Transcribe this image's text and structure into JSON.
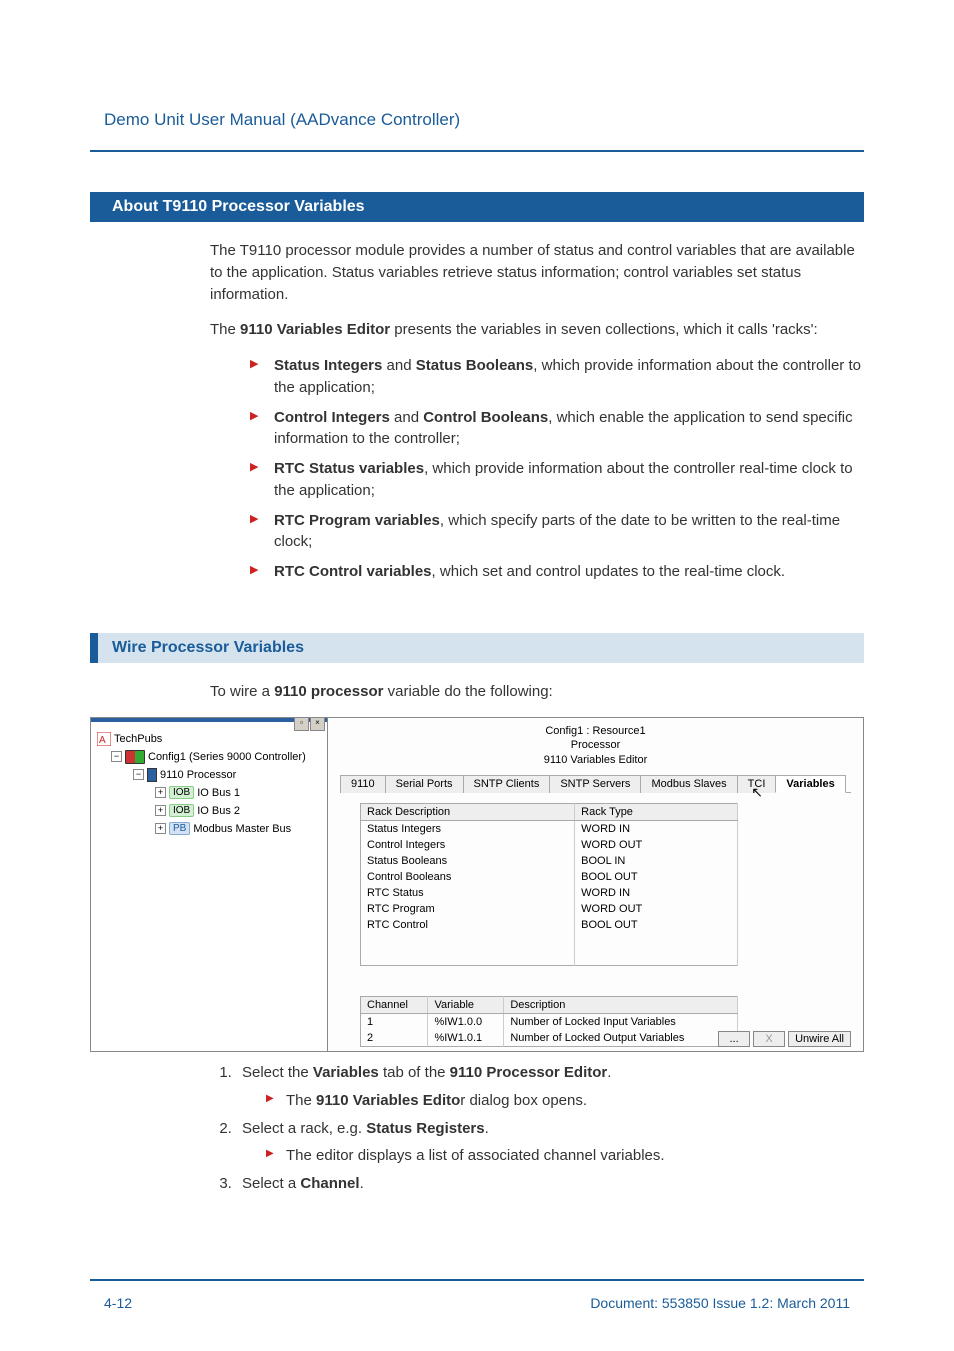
{
  "header": {
    "title": "Demo Unit User Manual  (AADvance Controller)"
  },
  "section1": {
    "heading": "About T9110 Processor Variables",
    "para1": "The T9110 processor module provides a number of status and control variables that are available to the application. Status variables retrieve status information; control variables set status information.",
    "para2_pre": "The ",
    "para2_b": "9110 Variables Editor",
    "para2_post": " presents the variables in seven collections, which it calls 'racks':",
    "bullets": {
      "b1_b1": "Status Integers",
      "b1_mid": " and ",
      "b1_b2": "Status Booleans",
      "b1_post": ", which provide information about the controller to the application;",
      "b2_b1": "Control Integers",
      "b2_mid": " and ",
      "b2_b2": "Control Booleans",
      "b2_post": ", which enable the application to send specific information to the controller;",
      "b3_b": "RTC Status variables",
      "b3_post": ", which provide information about the controller real-time clock to the application;",
      "b4_b": "RTC Program variables",
      "b4_post": ", which specify parts of the date to be written to the real-time clock;",
      "b5_b": "RTC Control variables",
      "b5_post": ", which set and control updates to the real-time clock."
    }
  },
  "section2": {
    "heading": "Wire Processor Variables",
    "intro_pre": "To wire a ",
    "intro_b": "9110 processor",
    "intro_post": " variable do the following:",
    "steps": {
      "s1_pre": "Select the ",
      "s1_b1": "Variables",
      "s1_mid": " tab of the ",
      "s1_b2": "9110 Processor Editor",
      "s1_post": ".",
      "s1_sub_pre": "The ",
      "s1_sub_b": "9110 Variables Edito",
      "s1_sub_post": "r dialog box opens.",
      "s2_pre": "Select a rack, e.g. ",
      "s2_b": "Status Registers",
      "s2_post": ".",
      "s2_sub": "The editor displays a list of associated channel variables.",
      "s3_pre": "Select a ",
      "s3_b": "Channel",
      "s3_post": "."
    }
  },
  "screenshot": {
    "tree": {
      "root": "TechPubs",
      "config": "Config1 (Series 9000 Controller)",
      "processor": "9110 Processor",
      "io1_chip": "IOB",
      "io1": "IO Bus 1",
      "io2_chip": "IOB",
      "io2": "IO Bus 2",
      "pb_chip": "PB",
      "pb": "Modbus Master Bus"
    },
    "right": {
      "crumb1": "Config1 : Resource1",
      "crumb2": "Processor",
      "crumb3": "9110 Variables Editor",
      "tabs": [
        "9110",
        "Serial Ports",
        "SNTP Clients",
        "SNTP Servers",
        "Modbus Slaves",
        "TCI",
        "Variables"
      ],
      "racks": {
        "col1": "Rack Description",
        "col2": "Rack Type",
        "rows": [
          [
            "Status Integers",
            "WORD IN"
          ],
          [
            "Control Integers",
            "WORD OUT"
          ],
          [
            "Status Booleans",
            "BOOL IN"
          ],
          [
            "Control Booleans",
            "BOOL OUT"
          ],
          [
            "RTC Status",
            "WORD IN"
          ],
          [
            "RTC Program",
            "WORD OUT"
          ],
          [
            "RTC Control",
            "BOOL OUT"
          ]
        ]
      },
      "channels": {
        "col1": "Channel",
        "col2": "Variable",
        "col3": "Description",
        "rows": [
          [
            "1",
            "%IW1.0.0",
            "Number of Locked Input Variables"
          ],
          [
            "2",
            "%IW1.0.1",
            "Number of Locked Output Variables"
          ]
        ]
      },
      "btn_more": "...",
      "btn_x": "X",
      "btn_unwire": "Unwire All"
    }
  },
  "footer": {
    "page": "4-12",
    "doc": "Document: 553850 Issue 1.2: March 2011"
  }
}
